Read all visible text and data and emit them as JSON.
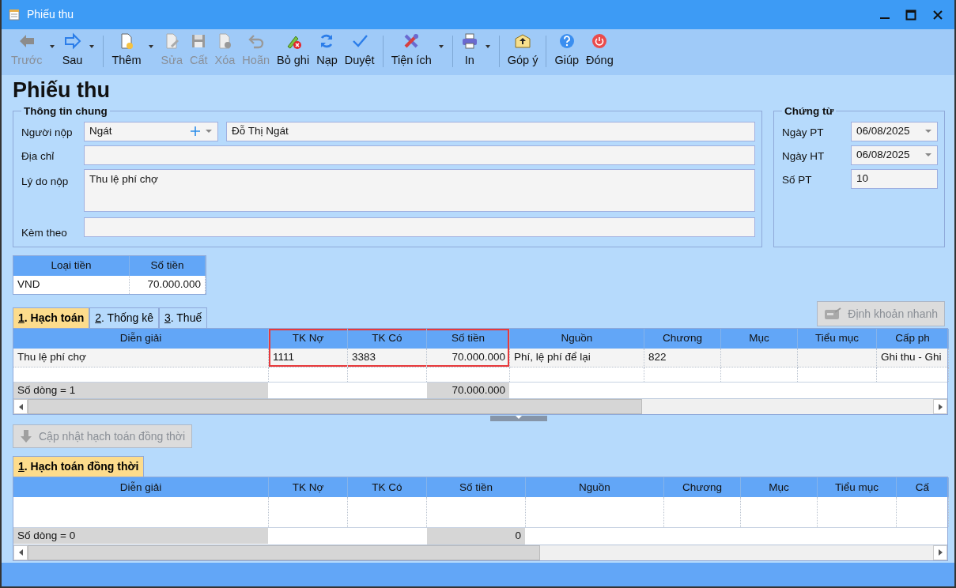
{
  "window": {
    "title": "Phiếu thu"
  },
  "toolbar": [
    {
      "label": "Trước",
      "disabled": true,
      "dropdown": true,
      "separator_after": false
    },
    {
      "label": "Sau",
      "disabled": false,
      "dropdown": true,
      "separator_after": true
    },
    {
      "label": "Thêm",
      "disabled": false,
      "dropdown": true,
      "separator_after": false
    },
    {
      "label": "Sửa",
      "disabled": true,
      "dropdown": false,
      "separator_after": false
    },
    {
      "label": "Cất",
      "disabled": true,
      "dropdown": false,
      "separator_after": false
    },
    {
      "label": "Xóa",
      "disabled": true,
      "dropdown": false,
      "separator_after": false
    },
    {
      "label": "Hoãn",
      "disabled": true,
      "dropdown": false,
      "separator_after": false
    },
    {
      "label": "Bỏ ghi",
      "disabled": false,
      "dropdown": false,
      "separator_after": false
    },
    {
      "label": "Nạp",
      "disabled": false,
      "dropdown": false,
      "separator_after": false
    },
    {
      "label": "Duyệt",
      "disabled": false,
      "dropdown": false,
      "separator_after": true
    },
    {
      "label": "Tiện ích",
      "disabled": false,
      "dropdown": true,
      "separator_after": true
    },
    {
      "label": "In",
      "disabled": false,
      "dropdown": true,
      "separator_after": true
    },
    {
      "label": "Góp ý",
      "disabled": false,
      "dropdown": false,
      "separator_after": true
    },
    {
      "label": "Giúp",
      "disabled": false,
      "dropdown": false,
      "separator_after": false
    },
    {
      "label": "Đóng",
      "disabled": false,
      "dropdown": false,
      "separator_after": false
    }
  ],
  "page_title": "Phiếu thu",
  "general": {
    "legend": "Thông tin chung",
    "fields": [
      {
        "label": "Người nộp",
        "kind": "payer",
        "code": "Ngát",
        "value": "Đỗ Thị Ngát"
      },
      {
        "label": "Địa chỉ",
        "kind": "text"
      },
      {
        "label": "Lý do nộp",
        "kind": "textarea",
        "value": "Thu lệ phí chợ"
      },
      {
        "label": "Kèm theo",
        "kind": "text"
      }
    ]
  },
  "voucher": {
    "legend": "Chứng từ",
    "fields": [
      {
        "label": "Ngày PT",
        "kind": "date",
        "value": "06/08/2025"
      },
      {
        "label": "Ngày HT",
        "kind": "date",
        "value": "06/08/2025"
      },
      {
        "label": "Số PT",
        "kind": "text",
        "value": "10"
      }
    ]
  },
  "currency": {
    "columns": [
      "Loại tiền",
      "Số tiền"
    ],
    "row": [
      "VND",
      "70.000.000"
    ]
  },
  "tabs": [
    {
      "hotkey": "1",
      "label": ". Hạch toán",
      "selected": true
    },
    {
      "hotkey": "2",
      "label": ". Thống kê",
      "selected": false
    },
    {
      "hotkey": "3",
      "label": ". Thuế",
      "selected": false
    }
  ],
  "quick_entry_button": {
    "label": "Định khoản nhanh",
    "disabled": true
  },
  "entries_grid": {
    "columns": [
      {
        "label": "Diễn giải",
        "highlighted": false
      },
      {
        "label": "TK Nợ",
        "highlighted": true
      },
      {
        "label": "TK Có",
        "highlighted": true
      },
      {
        "label": "Số tiền",
        "highlighted": true
      },
      {
        "label": "Nguồn",
        "highlighted": false
      },
      {
        "label": "Chương",
        "highlighted": false
      },
      {
        "label": "Mục",
        "highlighted": false
      },
      {
        "label": "Tiểu mục",
        "highlighted": false
      },
      {
        "label": "Cấp ph",
        "highlighted": false
      }
    ],
    "rows": [
      [
        "Thu lệ phí chợ",
        "1111",
        "3383",
        "70.000.000",
        "Phí, lệ phí để lại",
        "822",
        null,
        null,
        "Ghi thu - Ghi"
      ]
    ],
    "footer": {
      "count": "Số dòng = 1",
      "total": "70.000.000"
    }
  },
  "update_button": {
    "label": "Cập nhật hạch toán đồng thời",
    "disabled": true
  },
  "sub_tabs": [
    {
      "hotkey": "1",
      "label": ". Hạch toán đồng thời",
      "selected": true
    }
  ],
  "concurrent_grid": {
    "columns": [
      {
        "label": "Diễn giải",
        "highlighted": false
      },
      {
        "label": "TK Nợ",
        "highlighted": false
      },
      {
        "label": "TK Có",
        "highlighted": false
      },
      {
        "label": "Số tiền",
        "highlighted": false
      },
      {
        "label": "Nguồn",
        "highlighted": false
      },
      {
        "label": "Chương",
        "highlighted": false
      },
      {
        "label": "Mục",
        "highlighted": false
      },
      {
        "label": "Tiểu mục",
        "highlighted": false
      },
      {
        "label": "Cấ",
        "highlighted": false
      }
    ],
    "footer": {
      "count": "Số dòng = 0",
      "total": "0"
    }
  }
}
